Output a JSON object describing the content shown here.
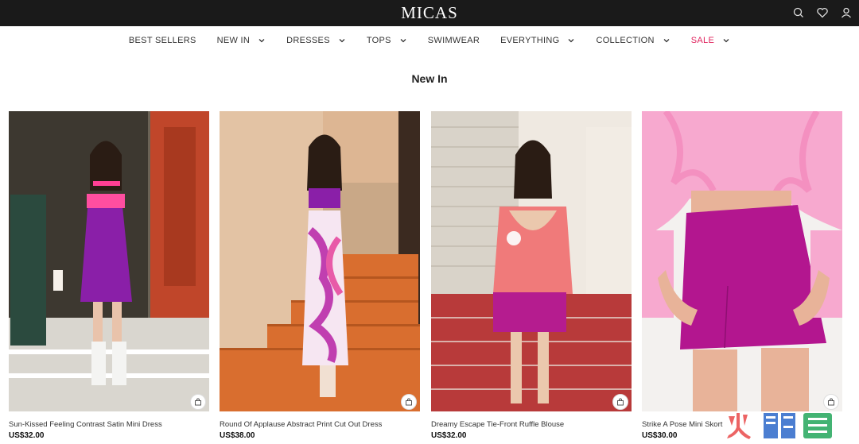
{
  "brand": {
    "logo": "MICAS"
  },
  "header_icons": [
    "search-icon",
    "heart-icon",
    "user-icon"
  ],
  "nav": {
    "items": [
      {
        "label": "BEST SELLERS",
        "dropdown": false
      },
      {
        "label": "NEW IN",
        "dropdown": true
      },
      {
        "label": "DRESSES",
        "dropdown": true
      },
      {
        "label": "TOPS",
        "dropdown": true
      },
      {
        "label": "SWIMWEAR",
        "dropdown": false
      },
      {
        "label": "EVERYTHING",
        "dropdown": true
      },
      {
        "label": "COLLECTION",
        "dropdown": true
      },
      {
        "label": "SALE",
        "dropdown": true
      }
    ],
    "sale_color": "#e0245e"
  },
  "section": {
    "title": "New In"
  },
  "products": [
    {
      "name": "Sun-Kissed Feeling Contrast Satin Mini Dress",
      "price": "US$32.00"
    },
    {
      "name": "Round Of Applause Abstract Print Cut Out Dress",
      "price": "US$38.00"
    },
    {
      "name": "Dreamy Escape Tie-Front Ruffle Blouse",
      "price": "US$32.00"
    },
    {
      "name": "Strike A Pose Mini Skort",
      "price": "US$30.00"
    }
  ],
  "colors": {
    "topbar": "#1a1a1a",
    "accent": "#e0245e"
  }
}
